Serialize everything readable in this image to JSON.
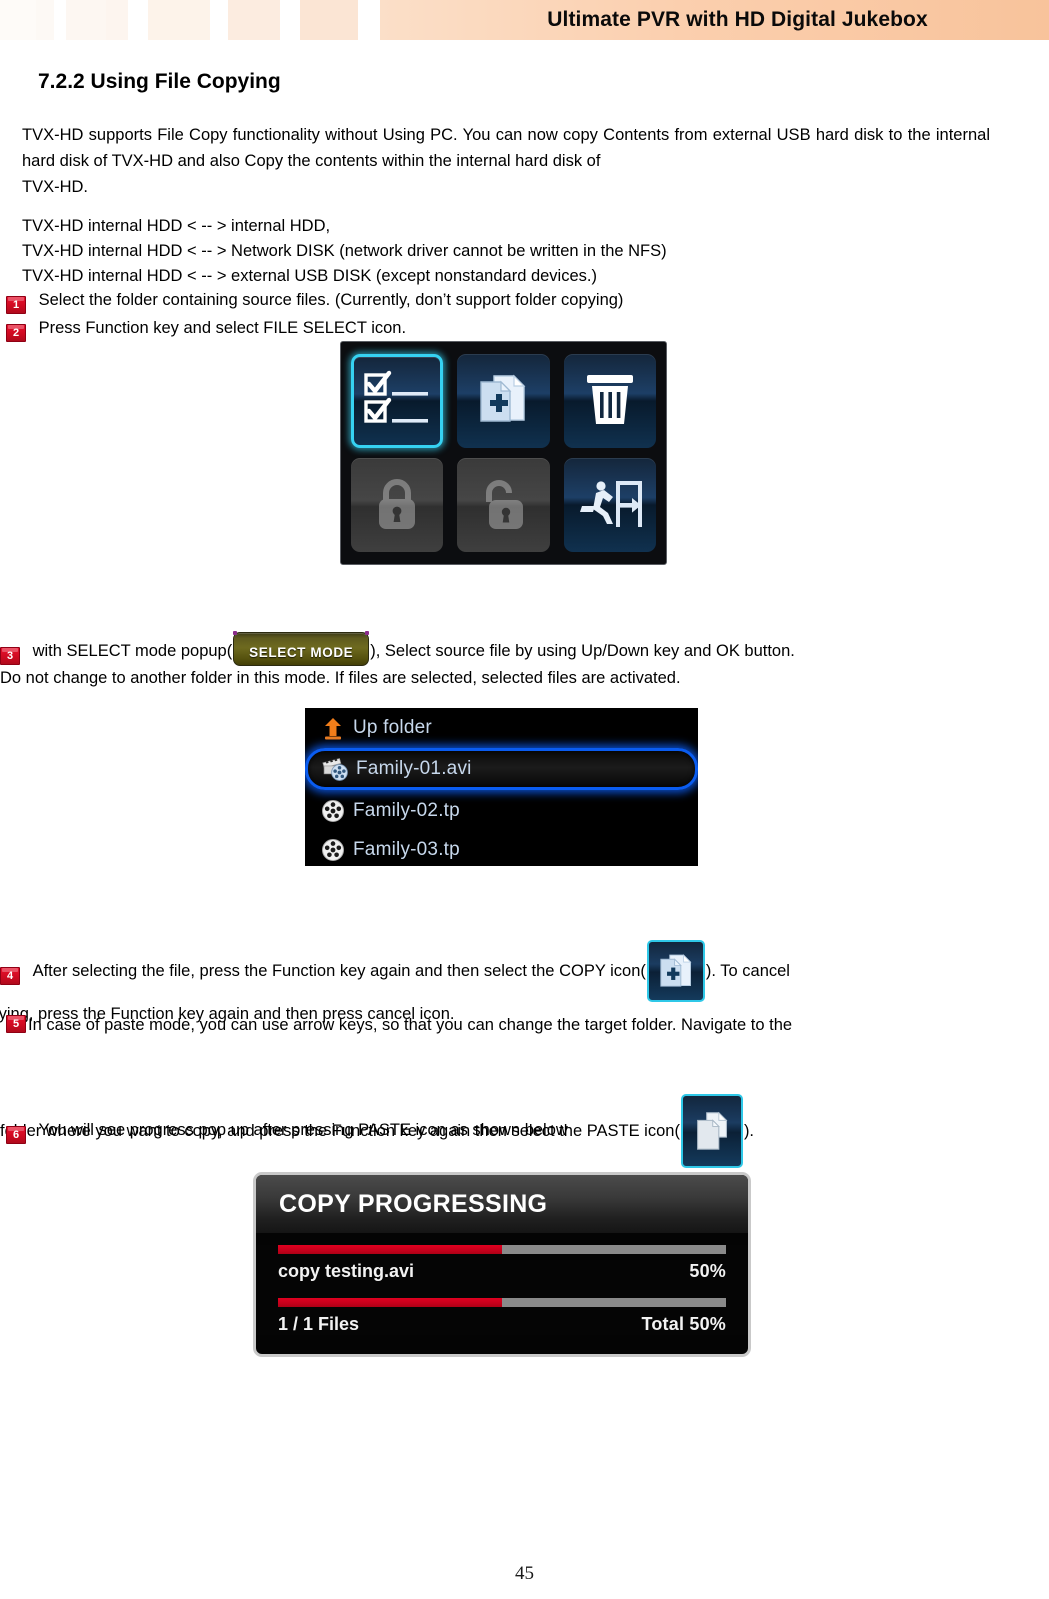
{
  "header": {
    "title": "Ultimate PVR with HD Digital Jukebox",
    "stripe_colors": [
      "#fefbf8",
      "#fdf9f5",
      "#ffffff",
      "#fdf6f1",
      "#fcf4ee",
      "#ffffff",
      "#fdf1e9",
      "#fdeee3",
      "#ffffff",
      "#fbe7d7",
      "#fae2ce",
      "#ffffff",
      "#f9d9c0"
    ]
  },
  "section": {
    "heading": "7.2.2 Using File Copying",
    "intro_paragraph": "TVX-HD supports File Copy functionality without Using PC. You can now copy Contents from external USB hard disk to the internal hard disk of TVX-HD and also Copy the contents within the internal hard disk of",
    "intro_lastline": "TVX-HD.",
    "hdd_paths": [
      "TVX-HD internal HDD < -- > internal HDD,",
      "TVX-HD internal HDD < -- > Network DISK (network driver cannot be written in the NFS)",
      "TVX-HD internal HDD < -- > external USB DISK (except nonstandard devices.)"
    ]
  },
  "steps": [
    {
      "num": "1",
      "text": "Select the folder containing source files. (Currently, don’t support folder copying)"
    },
    {
      "num": "2",
      "text": "Press Function key and select FILE SELECT icon."
    },
    {
      "num": "3",
      "text_before": "with SELECT mode popup(",
      "badge_label": "SELECT MODE",
      "text_after": "), Select source file by using Up/Down key and OK button.",
      "subtext": "Do not change to another folder in this mode. If files are selected, selected files are activated."
    },
    {
      "num": "4",
      "text_before": "After selecting the file, press the Function key again and then select the COPY icon(",
      "icon_name": "copy-icon",
      "text_after": "). To cancel",
      "subtext": "copying, press the Function key again and then press cancel icon."
    },
    {
      "num": "5",
      "text_before": "In case of paste mode, you can use arrow keys, so that you can change the target folder. Navigate to the",
      "text_middle": "folder where you want to copy, and press the Function key again then select the PASTE icon(",
      "icon_name": "paste-icon",
      "text_after": ")."
    },
    {
      "num": "6",
      "text": "You will see progress pop up after pressing PASTE icon as shown below"
    }
  ],
  "function_grid": {
    "tiles": [
      {
        "name": "file-select-icon",
        "label": "FILE SELECT",
        "state": "selected"
      },
      {
        "name": "copy-icon",
        "label": "COPY",
        "state": "enabled"
      },
      {
        "name": "delete-trash-icon",
        "label": "DELETE",
        "state": "enabled"
      },
      {
        "name": "lock-icon",
        "label": "LOCK",
        "state": "disabled"
      },
      {
        "name": "unlock-icon",
        "label": "UNLOCK",
        "state": "disabled"
      },
      {
        "name": "exit-icon",
        "label": "EXIT",
        "state": "enabled"
      }
    ],
    "selected_border_color": "#36d2f2"
  },
  "file_browser": {
    "rows": [
      {
        "icon": "up-folder-arrow-icon",
        "label": "Up folder",
        "selected": false
      },
      {
        "icon": "video-clapper-icon",
        "label": "Family-01.avi",
        "selected": true
      },
      {
        "icon": "film-reel-icon",
        "label": "Family-02.tp",
        "selected": false
      },
      {
        "icon": "film-reel-icon",
        "label": "Family-03.tp",
        "selected": false
      }
    ],
    "highlight_color": "#0a5cf0",
    "up_arrow_color": "#f07d1a"
  },
  "copy_dialog": {
    "title": "COPY PROGRESSING",
    "file_name": "copy testing.avi",
    "file_percent_label": "50%",
    "file_percent_value": 50,
    "files_count_label": "1 / 1 Files",
    "total_percent_label": "Total  50%",
    "total_percent_value": 50,
    "progress_fill_color": "#c6001b",
    "progress_track_color": "#8a8a8a"
  },
  "footer": {
    "page_number": "45"
  }
}
